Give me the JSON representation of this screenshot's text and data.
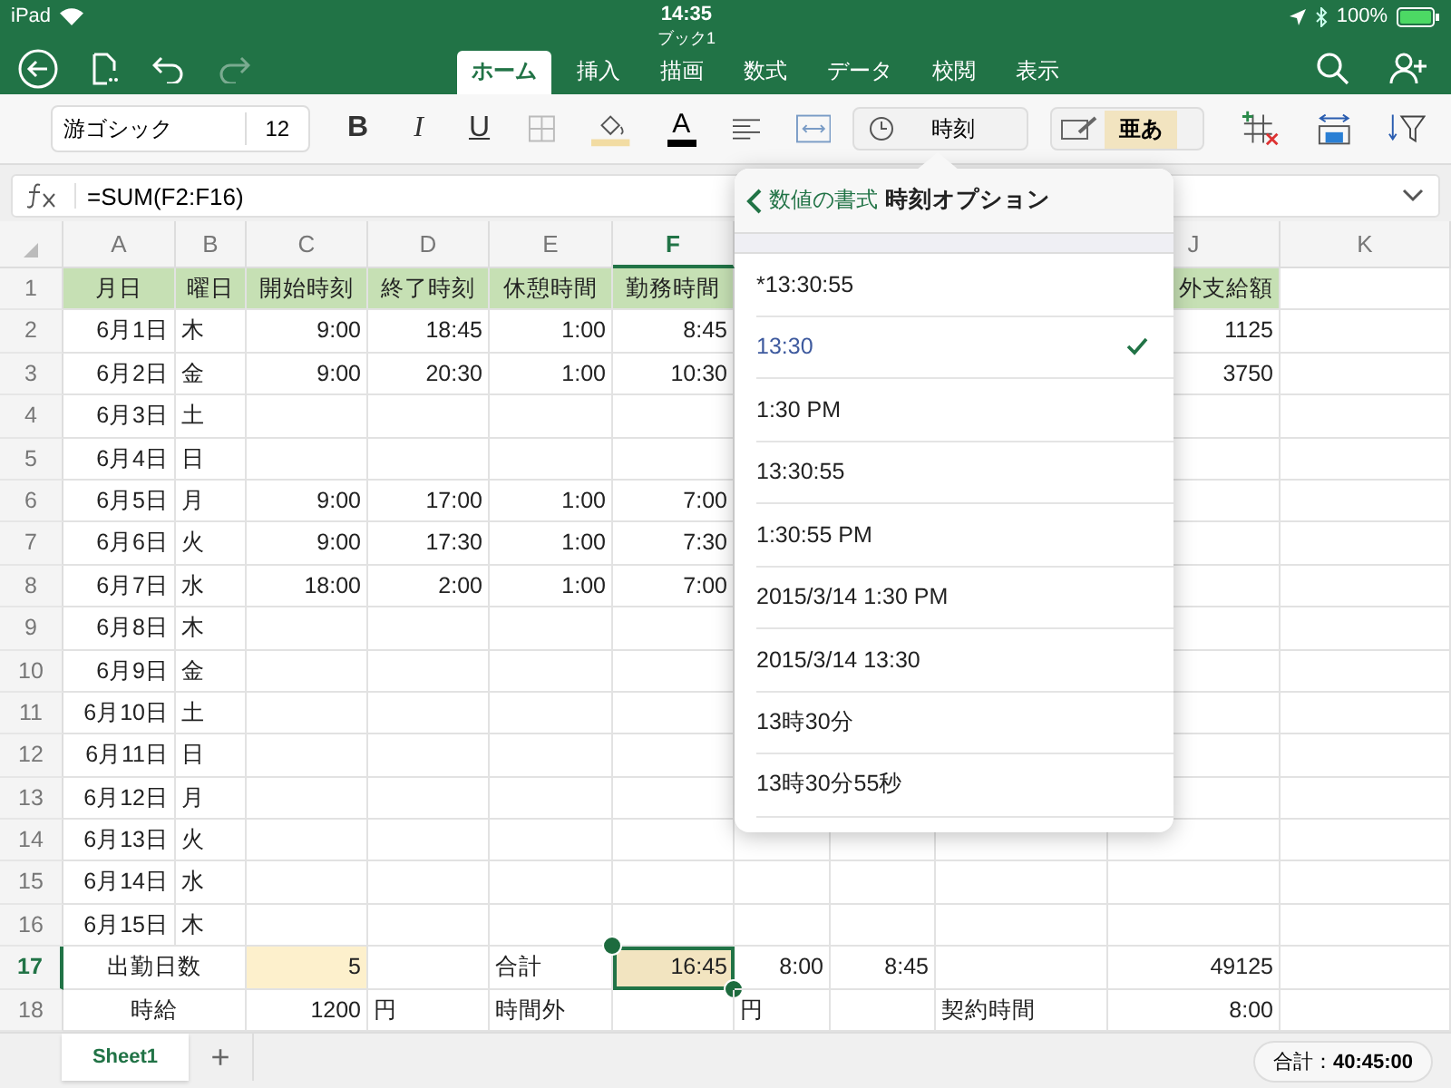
{
  "status_bar": {
    "device": "iPad",
    "time": "14:35",
    "battery": "100%"
  },
  "window": {
    "title": "ブック1"
  },
  "toolbar": {
    "undo": {
      "disabled": false
    },
    "redo": {
      "disabled": true
    }
  },
  "tabs": [
    {
      "label": "ホーム",
      "selected": true
    },
    {
      "label": "挿入",
      "selected": false
    },
    {
      "label": "描画",
      "selected": false
    },
    {
      "label": "数式",
      "selected": false
    },
    {
      "label": "データ",
      "selected": false
    },
    {
      "label": "校閲",
      "selected": false
    },
    {
      "label": "表示",
      "selected": false
    }
  ],
  "ribbon": {
    "font_name": "游ゴシック",
    "font_size": "12",
    "format_buttons": [
      "B",
      "I",
      "U"
    ],
    "font_color_label": "A",
    "number_format": "時刻",
    "cell_style": "亜あ"
  },
  "formula_bar": {
    "formula": "=SUM(F2:F16)"
  },
  "sheet": {
    "columns": [
      {
        "label": "A",
        "selected": false
      },
      {
        "label": "B",
        "selected": false
      },
      {
        "label": "C",
        "selected": false
      },
      {
        "label": "D",
        "selected": false
      },
      {
        "label": "E",
        "selected": false
      },
      {
        "label": "F",
        "selected": true
      },
      {
        "label": "J",
        "selected": false
      },
      {
        "label": "K",
        "selected": false
      }
    ],
    "rows": [
      {
        "label": "1",
        "selected": false,
        "kind": "header",
        "cells": [
          "月日",
          "曜日",
          "開始時刻",
          "終了時刻",
          "休憩時間",
          "勤務時間",
          "",
          "",
          "",
          {
            "text": "外支給額",
            "clipped": true,
            "selected": false,
            "highlighted": false
          }
        ]
      },
      {
        "label": "2",
        "selected": false,
        "kind": "data",
        "cells": [
          "6月1日",
          "木",
          "9:00",
          "18:45",
          "1:00",
          "8:45",
          "",
          "",
          "",
          "1125"
        ]
      },
      {
        "label": "3",
        "selected": false,
        "kind": "data",
        "cells": [
          "6月2日",
          "金",
          "9:00",
          "20:30",
          "1:00",
          "10:30",
          "",
          "",
          "",
          "3750"
        ]
      },
      {
        "label": "4",
        "selected": false,
        "kind": "data",
        "cells": [
          "6月3日",
          "土"
        ]
      },
      {
        "label": "5",
        "selected": false,
        "kind": "data",
        "cells": [
          "6月4日",
          "日"
        ]
      },
      {
        "label": "6",
        "selected": false,
        "kind": "data",
        "cells": [
          "6月5日",
          "月",
          "9:00",
          "17:00",
          "1:00",
          "7:00"
        ]
      },
      {
        "label": "7",
        "selected": false,
        "kind": "data",
        "cells": [
          "6月6日",
          "火",
          "9:00",
          "17:30",
          "1:00",
          "7:30"
        ]
      },
      {
        "label": "8",
        "selected": false,
        "kind": "data",
        "cells": [
          "6月7日",
          "水",
          "18:00",
          "2:00",
          "1:00",
          "7:00"
        ]
      },
      {
        "label": "9",
        "selected": false,
        "kind": "data",
        "cells": [
          "6月8日",
          "木"
        ]
      },
      {
        "label": "10",
        "selected": false,
        "kind": "data",
        "cells": [
          "6月9日",
          "金"
        ]
      },
      {
        "label": "11",
        "selected": false,
        "kind": "data",
        "cells": [
          "6月10日",
          "土"
        ]
      },
      {
        "label": "12",
        "selected": false,
        "kind": "data",
        "cells": [
          "6月11日",
          "日"
        ]
      },
      {
        "label": "13",
        "selected": false,
        "kind": "data",
        "cells": [
          "6月12日",
          "月"
        ]
      },
      {
        "label": "14",
        "selected": false,
        "kind": "data",
        "cells": [
          "6月13日",
          "火"
        ]
      },
      {
        "label": "15",
        "selected": false,
        "kind": "data",
        "cells": [
          "6月14日",
          "水"
        ]
      },
      {
        "label": "16",
        "selected": false,
        "kind": "data",
        "cells": [
          "6月15日",
          "木"
        ]
      },
      {
        "label": "17",
        "selected": true,
        "kind": "data",
        "cells": [
          {
            "text": "出勤日数",
            "merged": true,
            "selected": false,
            "highlighted": false
          },
          "",
          {
            "text": "5",
            "selected": false,
            "highlighted": true
          },
          "",
          "合計",
          {
            "text": "16:45",
            "selected": true,
            "highlighted": true
          },
          "8:00",
          "8:45",
          "",
          "49125"
        ]
      },
      {
        "label": "18",
        "selected": false,
        "kind": "data",
        "cells": [
          {
            "text": "時給",
            "merged": true,
            "selected": false,
            "highlighted": false
          },
          "",
          "1200",
          "円",
          "時間外",
          "",
          "円",
          "",
          "契約時間",
          "8:00"
        ]
      }
    ]
  },
  "popover": {
    "back": "数値の書式",
    "title": "時刻オプション",
    "items": [
      {
        "text": "*13:30:55",
        "selected": false
      },
      {
        "text": "13:30",
        "selected": true
      },
      {
        "text": "1:30 PM",
        "selected": false
      },
      {
        "text": "13:30:55",
        "selected": false
      },
      {
        "text": "1:30:55 PM",
        "selected": false
      },
      {
        "text": "2015/3/14 1:30 PM",
        "selected": false
      },
      {
        "text": "2015/3/14 13:30",
        "selected": false
      },
      {
        "text": "13時30分",
        "selected": false
      },
      {
        "text": "13時30分55秒",
        "selected": false
      }
    ]
  },
  "sheet_tabs": [
    {
      "label": "Sheet1",
      "selected": true
    }
  ],
  "add_sheet": "+",
  "status_sum": "合計：**40:45:00**"
}
